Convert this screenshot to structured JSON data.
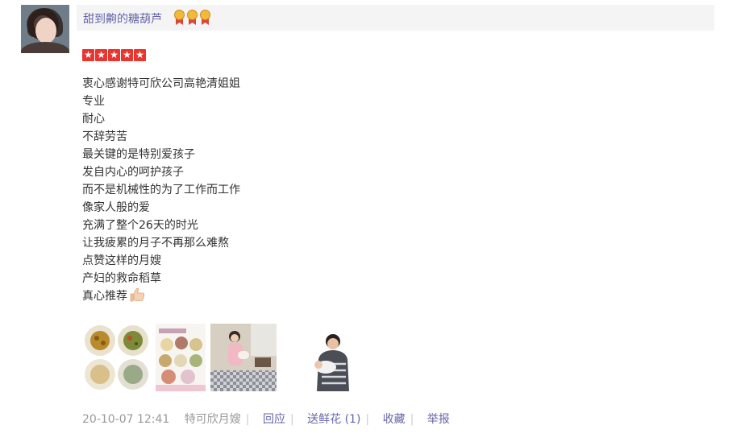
{
  "user": {
    "name": "甜到齁的糖葫芦",
    "medal_count": 3,
    "rating_stars": 5
  },
  "review_lines": [
    "衷心感谢特可欣公司高艳清姐姐",
    "专业",
    "耐心",
    "不辞劳苦",
    "最关键的是特别爱孩子",
    "发自内心的呵护孩子",
    "而不是机械性的为了工作而工作",
    "像家人般的爱",
    "充满了整个26天的时光",
    "让我疲累的月子不再那么难熬",
    "点赞这样的月嫂",
    "产妇的救命稻草",
    "真心推荐"
  ],
  "footer": {
    "datetime": "20-10-07 12:41",
    "source": "特可欣月嫂",
    "reply": "回应",
    "flowers": "送鲜花 (1)",
    "favorite": "收藏",
    "report": "举报",
    "separator": "|"
  },
  "colors": {
    "link": "#6666aa",
    "star": "#e8352f",
    "meta": "#999999",
    "name_bar": "#f4f4f4"
  },
  "icons": {
    "thumbs_up": "thumbs-up-icon",
    "medal": "medal-icon",
    "star": "star-icon"
  }
}
